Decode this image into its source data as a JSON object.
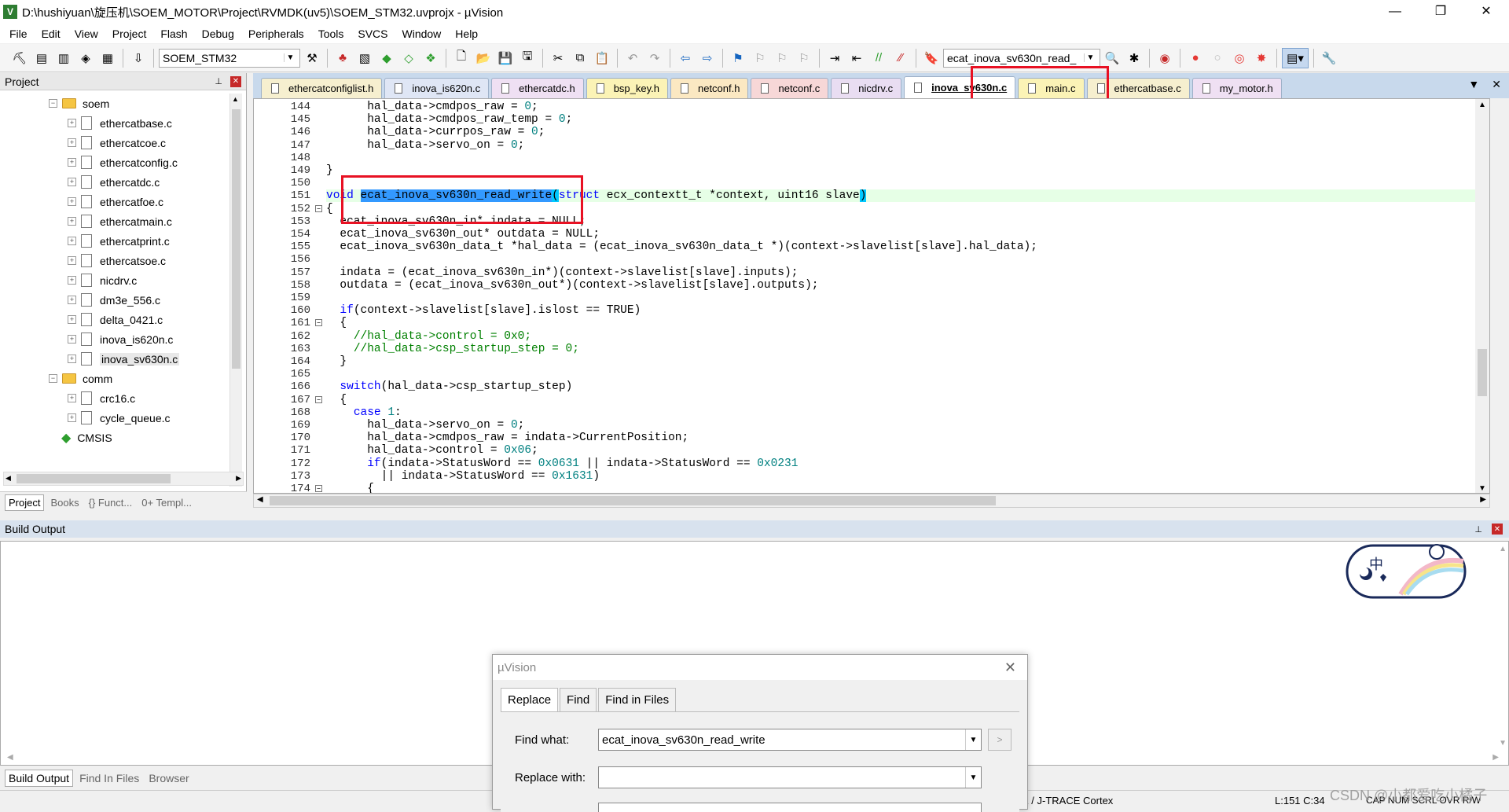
{
  "window": {
    "title": "D:\\hushiyuan\\旋压机\\SOEM_MOTOR\\Project\\RVMDK(uv5)\\SOEM_STM32.uvprojx - µVision",
    "minimize": "—",
    "restore": "❐",
    "close": "✕"
  },
  "menu": [
    "File",
    "Edit",
    "View",
    "Project",
    "Flash",
    "Debug",
    "Peripherals",
    "Tools",
    "SVCS",
    "Window",
    "Help"
  ],
  "toolbar": {
    "target": "SOEM_STM32",
    "find_combo": "ecat_inova_sv630n_read_"
  },
  "project_panel": {
    "title": "Project",
    "pin": "📌",
    "tree": [
      {
        "label": "soem",
        "type": "folder",
        "level": 1
      },
      {
        "label": "ethercatbase.c",
        "type": "file",
        "level": 2
      },
      {
        "label": "ethercatcoe.c",
        "type": "file",
        "level": 2
      },
      {
        "label": "ethercatconfig.c",
        "type": "file",
        "level": 2
      },
      {
        "label": "ethercatdc.c",
        "type": "file",
        "level": 2
      },
      {
        "label": "ethercatfoe.c",
        "type": "file",
        "level": 2
      },
      {
        "label": "ethercatmain.c",
        "type": "file",
        "level": 2
      },
      {
        "label": "ethercatprint.c",
        "type": "file",
        "level": 2
      },
      {
        "label": "ethercatsoe.c",
        "type": "file",
        "level": 2
      },
      {
        "label": "nicdrv.c",
        "type": "file",
        "level": 2
      },
      {
        "label": "dm3e_556.c",
        "type": "file",
        "level": 2
      },
      {
        "label": "delta_0421.c",
        "type": "file",
        "level": 2
      },
      {
        "label": "inova_is620n.c",
        "type": "file",
        "level": 2
      },
      {
        "label": "inova_sv630n.c",
        "type": "file",
        "level": 2,
        "selected": true
      },
      {
        "label": "comm",
        "type": "folder",
        "level": 1
      },
      {
        "label": "crc16.c",
        "type": "file",
        "level": 2
      },
      {
        "label": "cycle_queue.c",
        "type": "file",
        "level": 2
      },
      {
        "label": "CMSIS",
        "type": "cmsis",
        "level": 1
      }
    ],
    "tabs": [
      "Project",
      "Books",
      "{} Funct...",
      "0+ Templ..."
    ]
  },
  "editor_tabs": [
    {
      "label": "ethercatconfiglist.h",
      "color": "#f6efcf"
    },
    {
      "label": "inova_is620n.c",
      "color": "#dfe6f5"
    },
    {
      "label": "ethercatdc.h",
      "color": "#efe0f3"
    },
    {
      "label": "bsp_key.h",
      "color": "#fbf3b6"
    },
    {
      "label": "netconf.h",
      "color": "#fbe8c2"
    },
    {
      "label": "netconf.c",
      "color": "#f7d7d7"
    },
    {
      "label": "nicdrv.c",
      "color": "#e9ddf2"
    },
    {
      "label": "inova_sv630n.c",
      "color": "#ffffff",
      "active": true
    },
    {
      "label": "main.c",
      "color": "#fbf3b6"
    },
    {
      "label": "ethercatbase.c",
      "color": "#f6efcf"
    },
    {
      "label": "my_motor.h",
      "color": "#efe0f3"
    }
  ],
  "code": {
    "lines": [
      {
        "n": "144",
        "t": "      hal_data->cmdpos_raw = 0;"
      },
      {
        "n": "145",
        "t": "      hal_data->cmdpos_raw_temp = 0;"
      },
      {
        "n": "146",
        "t": "      hal_data->currpos_raw = 0;"
      },
      {
        "n": "147",
        "t": "      hal_data->servo_on = 0;"
      },
      {
        "n": "148",
        "t": ""
      },
      {
        "n": "149",
        "t": "}"
      },
      {
        "n": "150",
        "t": ""
      },
      {
        "n": "151",
        "t": "void ecat_inova_sv630n_read_write(struct ecx_contextt_t *context, uint16 slave)"
      },
      {
        "n": "152",
        "t": "{"
      },
      {
        "n": "153",
        "t": "  ecat_inova_sv630n_in* indata = NULL;"
      },
      {
        "n": "154",
        "t": "  ecat_inova_sv630n_out* outdata = NULL;"
      },
      {
        "n": "155",
        "t": "  ecat_inova_sv630n_data_t *hal_data = (ecat_inova_sv630n_data_t *)(context->slavelist[slave].hal_data);"
      },
      {
        "n": "156",
        "t": ""
      },
      {
        "n": "157",
        "t": "  indata = (ecat_inova_sv630n_in*)(context->slavelist[slave].inputs);"
      },
      {
        "n": "158",
        "t": "  outdata = (ecat_inova_sv630n_out*)(context->slavelist[slave].outputs);"
      },
      {
        "n": "159",
        "t": ""
      },
      {
        "n": "160",
        "t": "  if(context->slavelist[slave].islost == TRUE)"
      },
      {
        "n": "161",
        "t": "  {"
      },
      {
        "n": "162",
        "t": "    //hal_data->control = 0x0;"
      },
      {
        "n": "163",
        "t": "    //hal_data->csp_startup_step = 0;"
      },
      {
        "n": "164",
        "t": "  }"
      },
      {
        "n": "165",
        "t": ""
      },
      {
        "n": "166",
        "t": "  switch(hal_data->csp_startup_step)"
      },
      {
        "n": "167",
        "t": "  {"
      },
      {
        "n": "168",
        "t": "    case 1:"
      },
      {
        "n": "169",
        "t": "      hal_data->servo_on = 0;"
      },
      {
        "n": "170",
        "t": "      hal_data->cmdpos_raw = indata->CurrentPosition;"
      },
      {
        "n": "171",
        "t": "      hal_data->control = 0x06;"
      },
      {
        "n": "172",
        "t": "      if(indata->StatusWord == 0x0631 || indata->StatusWord == 0x0231"
      },
      {
        "n": "173",
        "t": "        || indata->StatusWord == 0x1631)"
      },
      {
        "n": "174",
        "t": "      {"
      }
    ]
  },
  "build_output": {
    "title": "Build Output",
    "tabs": [
      "Build Output",
      "Find In Files",
      "Browser"
    ]
  },
  "statusbar": {
    "debugger": "K / J-TRACE Cortex",
    "position": "L:151 C:34",
    "flags": "CAP  NUM  SCRL  OVR  R/W"
  },
  "dialog": {
    "title": "µVision",
    "tabs": [
      "Replace",
      "Find",
      "Find in Files"
    ],
    "find_label": "Find what:",
    "find_value": "ecat_inova_sv630n_read_write",
    "replace_label": "Replace with:",
    "replace_value": ""
  },
  "mascot": {
    "glyph": "中"
  },
  "watermark": "CSDN @小都爱吃小橘子"
}
